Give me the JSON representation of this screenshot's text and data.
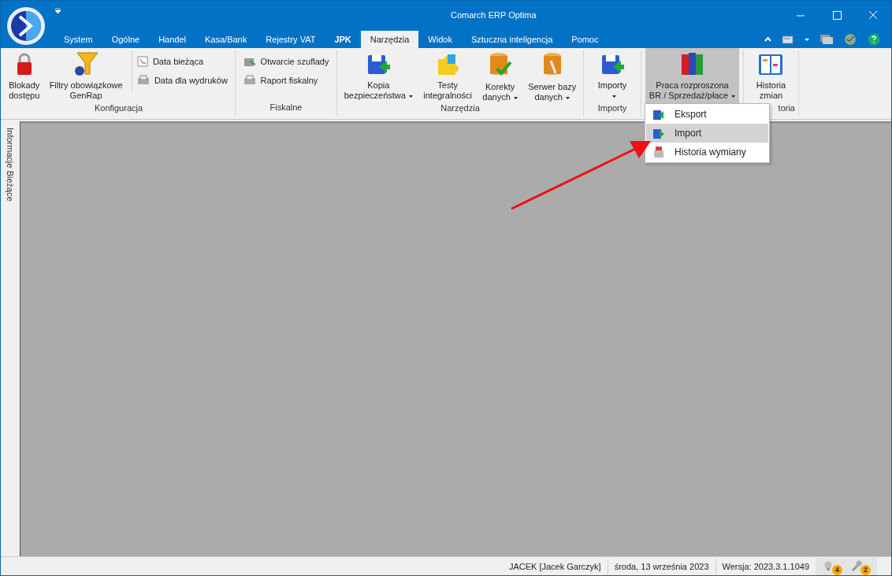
{
  "window": {
    "title": "Comarch ERP Optima"
  },
  "tabs": [
    {
      "label": "System",
      "selected": false,
      "bold": false
    },
    {
      "label": "Ogólne",
      "selected": false,
      "bold": false
    },
    {
      "label": "Handel",
      "selected": false,
      "bold": false
    },
    {
      "label": "Kasa/Bank",
      "selected": false,
      "bold": false
    },
    {
      "label": "Rejestry VAT",
      "selected": false,
      "bold": false
    },
    {
      "label": "JPK",
      "selected": false,
      "bold": true
    },
    {
      "label": "Narzędzia",
      "selected": true,
      "bold": false
    },
    {
      "label": "Widok",
      "selected": false,
      "bold": false
    },
    {
      "label": "Sztuczna inteligencja",
      "selected": false,
      "bold": false
    },
    {
      "label": "Pomoc",
      "selected": false,
      "bold": false
    }
  ],
  "ribbon_groups": [
    {
      "label": "Konfiguracja",
      "items": [
        {
          "kind": "large",
          "lines": [
            "Blokady",
            "dostępu"
          ],
          "dropdown": false,
          "expanded": false
        },
        {
          "kind": "large",
          "lines": [
            "Filtry obowiązkowe",
            "GenRap"
          ],
          "dropdown": false,
          "expanded": false
        },
        {
          "kind": "small",
          "lines": [
            "Data bieżąca"
          ]
        },
        {
          "kind": "small",
          "lines": [
            "Data dla wydruków"
          ]
        }
      ]
    },
    {
      "label": "Fiskalne",
      "items": [
        {
          "kind": "small",
          "lines": [
            "Otwarcie szuflady"
          ]
        },
        {
          "kind": "small",
          "lines": [
            "Raport fiskalny"
          ]
        }
      ]
    },
    {
      "label": "Narzędzia",
      "items": [
        {
          "kind": "large",
          "lines": [
            "Kopia",
            "bezpieczeństwa"
          ],
          "dropdown": true,
          "expanded": false
        },
        {
          "kind": "large",
          "lines": [
            "Testy",
            "integralności"
          ],
          "dropdown": false,
          "expanded": false
        },
        {
          "kind": "large",
          "lines": [
            "Korekty",
            "danych"
          ],
          "dropdown": true,
          "expanded": false
        },
        {
          "kind": "large",
          "lines": [
            "Serwer bazy",
            "danych"
          ],
          "dropdown": true,
          "expanded": false
        }
      ]
    },
    {
      "label": "Importy",
      "items": [
        {
          "kind": "large",
          "lines": [
            "Importy"
          ],
          "dropdown": true,
          "expanded": false
        }
      ]
    },
    {
      "items": [
        {
          "kind": "large",
          "lines": [
            "Praca rozproszona",
            "BR / Sprzedaż/płace"
          ],
          "dropdown": true,
          "expanded": true
        }
      ]
    },
    {
      "label": "toria",
      "items": [
        {
          "kind": "large",
          "lines": [
            "Historia",
            "zmian"
          ],
          "dropdown": false,
          "expanded": false
        }
      ]
    }
  ],
  "dropdown_menu": [
    {
      "label": "Eksport",
      "selected": false
    },
    {
      "label": "Import",
      "selected": true
    },
    {
      "label": "Historia wymiany",
      "selected": false
    }
  ],
  "side_panel": {
    "label": "Informacje Bieżące"
  },
  "status_bar": {
    "user": "JACEK [Jacek Garczyk]",
    "date": "środa, 13 września 2023",
    "version": "Wersja: 2023.3.1.1049",
    "badges": [
      "4",
      "2"
    ]
  }
}
